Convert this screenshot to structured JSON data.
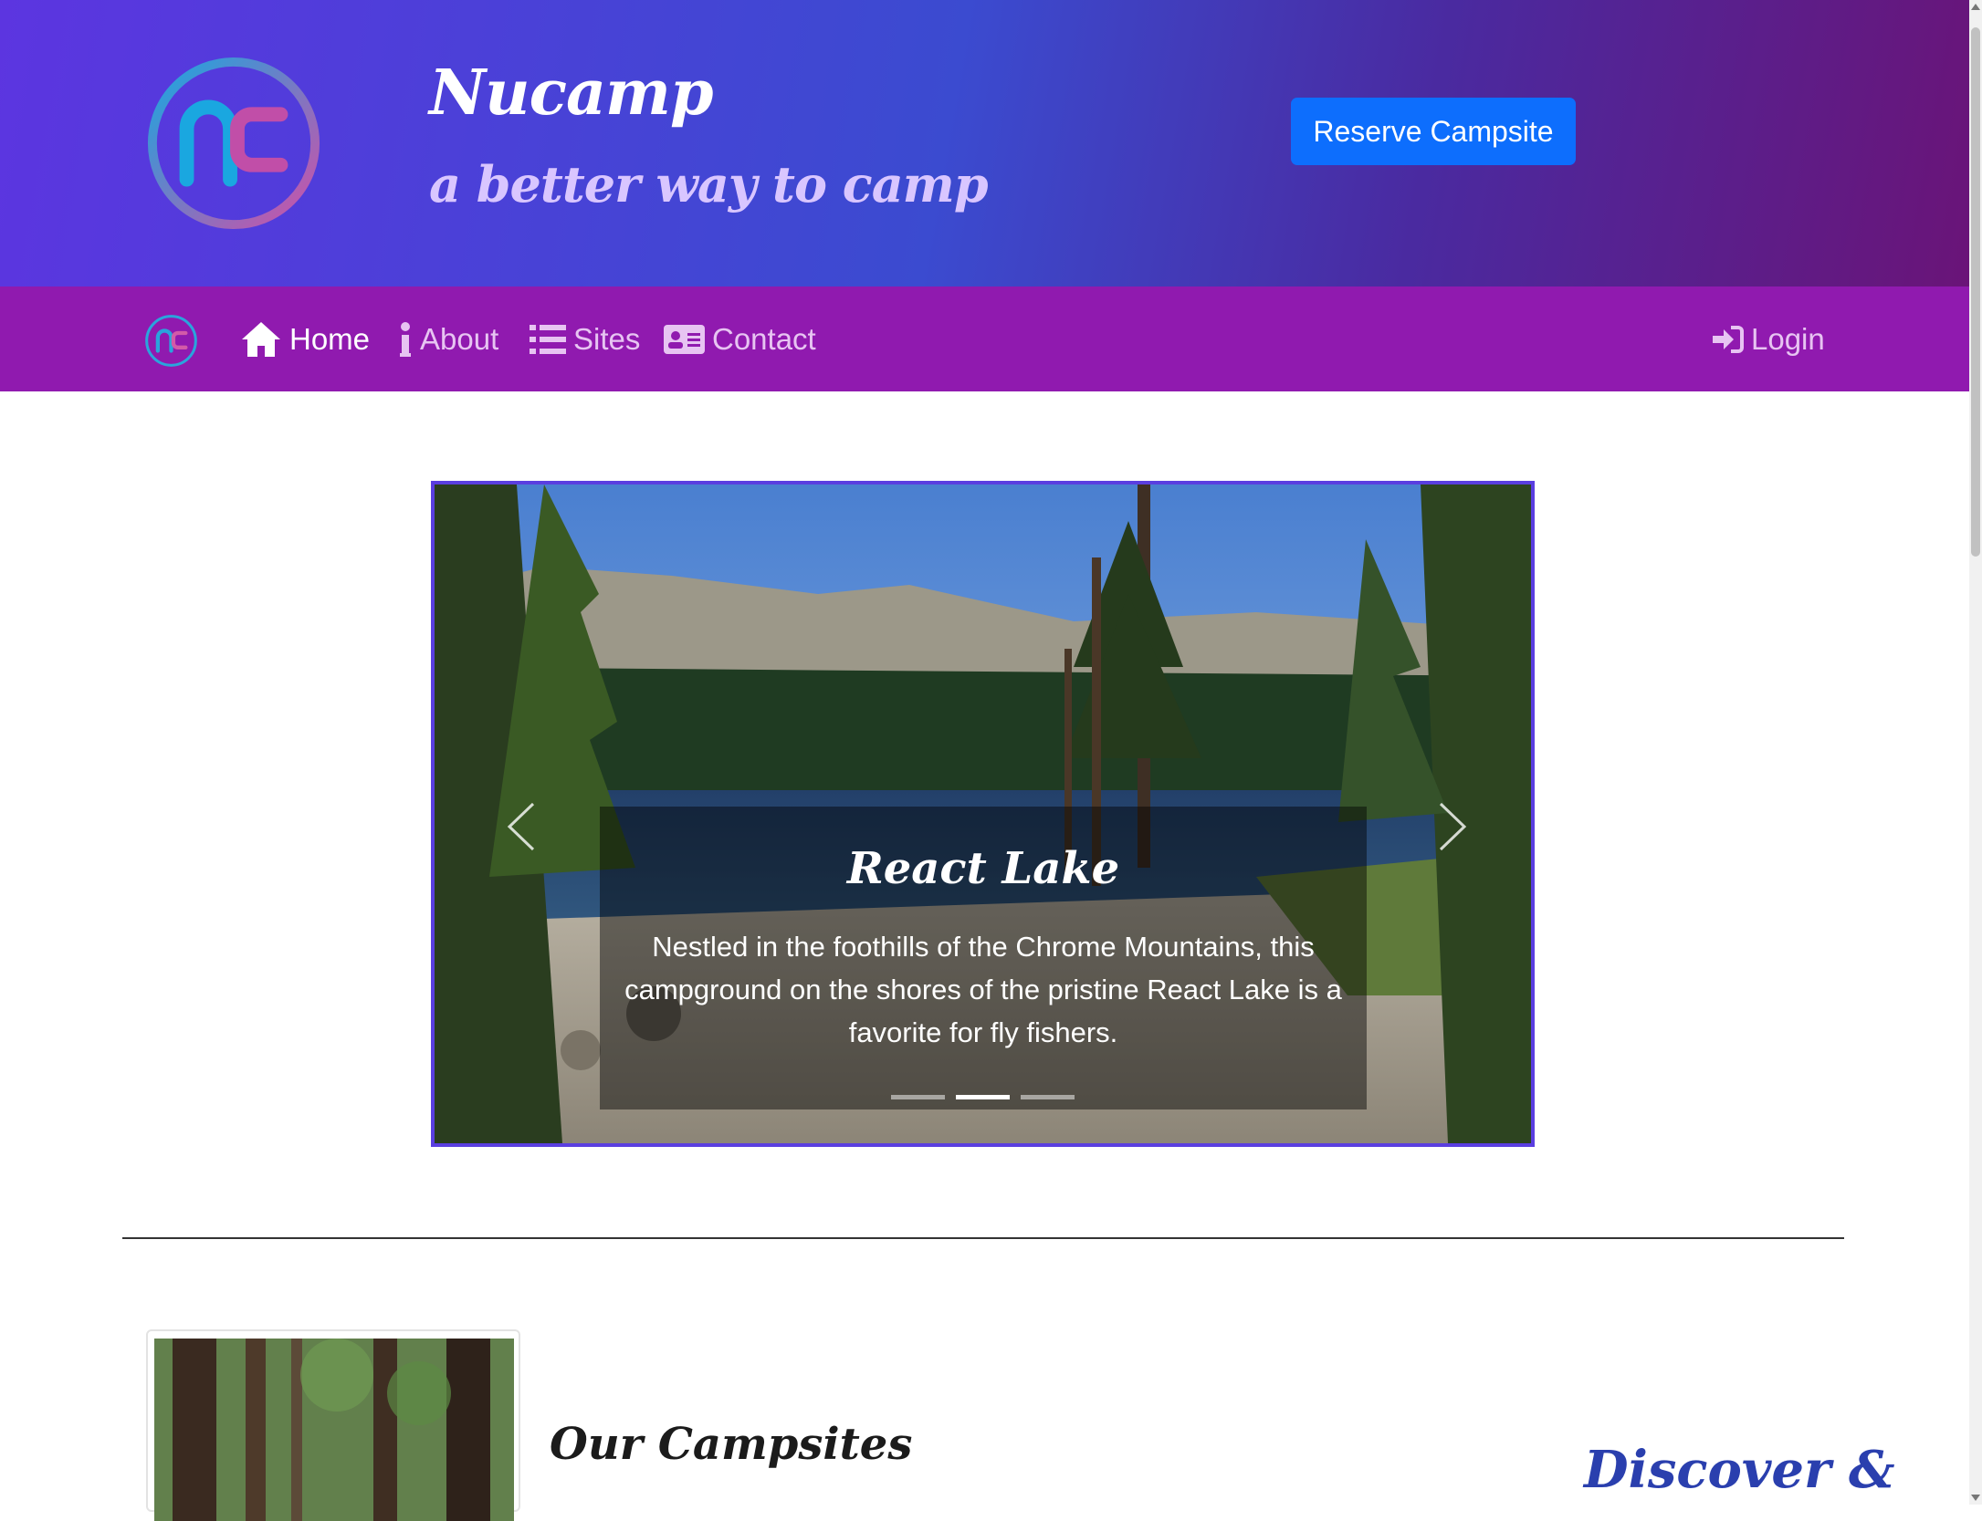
{
  "header": {
    "brand_title": "Nucamp",
    "brand_subtitle": "a better way to camp",
    "reserve_button": "Reserve Campsite"
  },
  "navbar": {
    "items": [
      {
        "label": "Home",
        "icon": "home-icon",
        "active": true
      },
      {
        "label": "About",
        "icon": "info-icon",
        "active": false
      },
      {
        "label": "Sites",
        "icon": "list-icon",
        "active": false
      },
      {
        "label": "Contact",
        "icon": "address-card-icon",
        "active": false
      }
    ],
    "login": {
      "label": "Login",
      "icon": "sign-in-icon"
    }
  },
  "carousel": {
    "title": "React Lake",
    "text": "Nestled in the foothills of the Chrome Mountains, this campground on the shores of the pristine React Lake is a favorite for fly fishers.",
    "slide_count": 3,
    "active_index": 1
  },
  "sections": {
    "campsites_title": "Our Campsites",
    "discover_title": "Discover &"
  },
  "colors": {
    "header_gradient_start": "#5c35e0",
    "header_gradient_end": "#6a1478",
    "navbar": "#901aaf",
    "reserve_button": "#0d6efd",
    "carousel_border": "#5a3ee0",
    "discover_title": "#2a3fae"
  }
}
